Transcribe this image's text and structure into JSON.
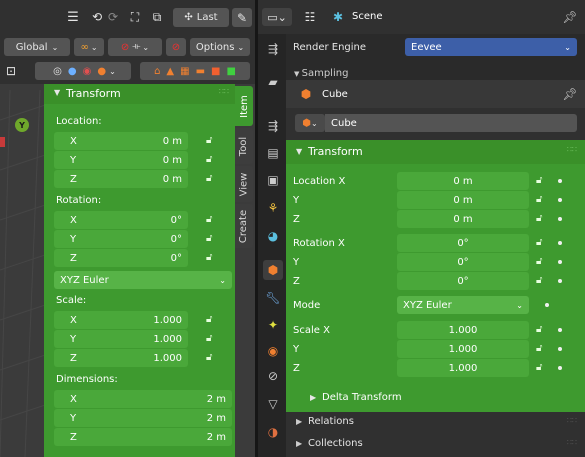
{
  "top_toolbar": {
    "transform_pivot_label": "Last",
    "icons": [
      "hamburger-icon",
      "undo-icon",
      "redo-icon",
      "snap-icon",
      "view-icon",
      "lasso-icon",
      "settings-icon",
      "search-icon"
    ]
  },
  "header_toolbar": {
    "orientation": "Global",
    "options_label": "Options"
  },
  "sidebar": {
    "tabs": [
      "Item",
      "Tool",
      "View",
      "Create"
    ],
    "transform": {
      "title": "Transform",
      "location_label": "Location:",
      "location": [
        {
          "axis": "X",
          "value": "0 m"
        },
        {
          "axis": "Y",
          "value": "0 m"
        },
        {
          "axis": "Z",
          "value": "0 m"
        }
      ],
      "rotation_label": "Rotation:",
      "rotation": [
        {
          "axis": "X",
          "value": "0°"
        },
        {
          "axis": "Y",
          "value": "0°"
        },
        {
          "axis": "Z",
          "value": "0°"
        }
      ],
      "rotation_mode": "XYZ Euler",
      "scale_label": "Scale:",
      "scale": [
        {
          "axis": "X",
          "value": "1.000"
        },
        {
          "axis": "Y",
          "value": "1.000"
        },
        {
          "axis": "Z",
          "value": "1.000"
        }
      ],
      "dimensions_label": "Dimensions:",
      "dimensions": [
        {
          "axis": "X",
          "value": "2 m"
        },
        {
          "axis": "Y",
          "value": "2 m"
        },
        {
          "axis": "Z",
          "value": "2 m"
        }
      ]
    }
  },
  "properties": {
    "scene_header": {
      "title": "Scene"
    },
    "render_engine": {
      "label": "Render Engine",
      "value": "Eevee"
    },
    "sampling_label": "Sampling",
    "object_header": {
      "title": "Cube"
    },
    "object_name": "Cube",
    "transform": {
      "title": "Transform",
      "location": [
        {
          "label": "Location X",
          "value": "0 m"
        },
        {
          "label": "Y",
          "value": "0 m"
        },
        {
          "label": "Z",
          "value": "0 m"
        }
      ],
      "rotation": [
        {
          "label": "Rotation X",
          "value": "0°"
        },
        {
          "label": "Y",
          "value": "0°"
        },
        {
          "label": "Z",
          "value": "0°"
        }
      ],
      "mode": {
        "label": "Mode",
        "value": "XYZ Euler"
      },
      "scale": [
        {
          "label": "Scale X",
          "value": "1.000"
        },
        {
          "label": "Y",
          "value": "1.000"
        },
        {
          "label": "Z",
          "value": "1.000"
        }
      ],
      "delta_label": "Delta Transform"
    },
    "relations_label": "Relations",
    "collections_label": "Collections"
  },
  "colors": {
    "accent_green": "#3e9a2f",
    "field_green": "#4aa83a",
    "panel_dark": "#2c2c2c"
  }
}
